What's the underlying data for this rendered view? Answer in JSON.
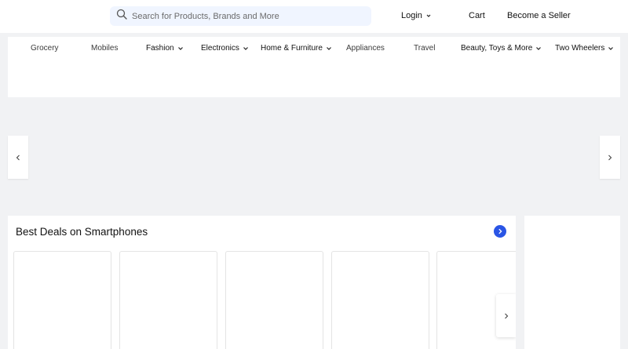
{
  "search": {
    "placeholder": "Search for Products, Brands and More"
  },
  "header": {
    "login_label": "Login",
    "cart_label": "Cart",
    "seller_label": "Become a Seller"
  },
  "categories": [
    {
      "label": "Grocery"
    },
    {
      "label": "Mobiles"
    },
    {
      "label": "Fashion"
    },
    {
      "label": "Electronics"
    },
    {
      "label": "Home & Furniture"
    },
    {
      "label": "Appliances"
    },
    {
      "label": "Travel"
    },
    {
      "label": "Beauty, Toys & More"
    },
    {
      "label": "Two Wheelers"
    }
  ],
  "deals": {
    "title": "Best Deals on Smartphones"
  },
  "colors": {
    "accent": "#2a55e5",
    "search_bg": "#f0f5ff",
    "page_bg": "#f1f2f4"
  },
  "icons": [
    "search-icon",
    "chevron-down-icon",
    "chevron-left-icon",
    "chevron-right-icon"
  ]
}
